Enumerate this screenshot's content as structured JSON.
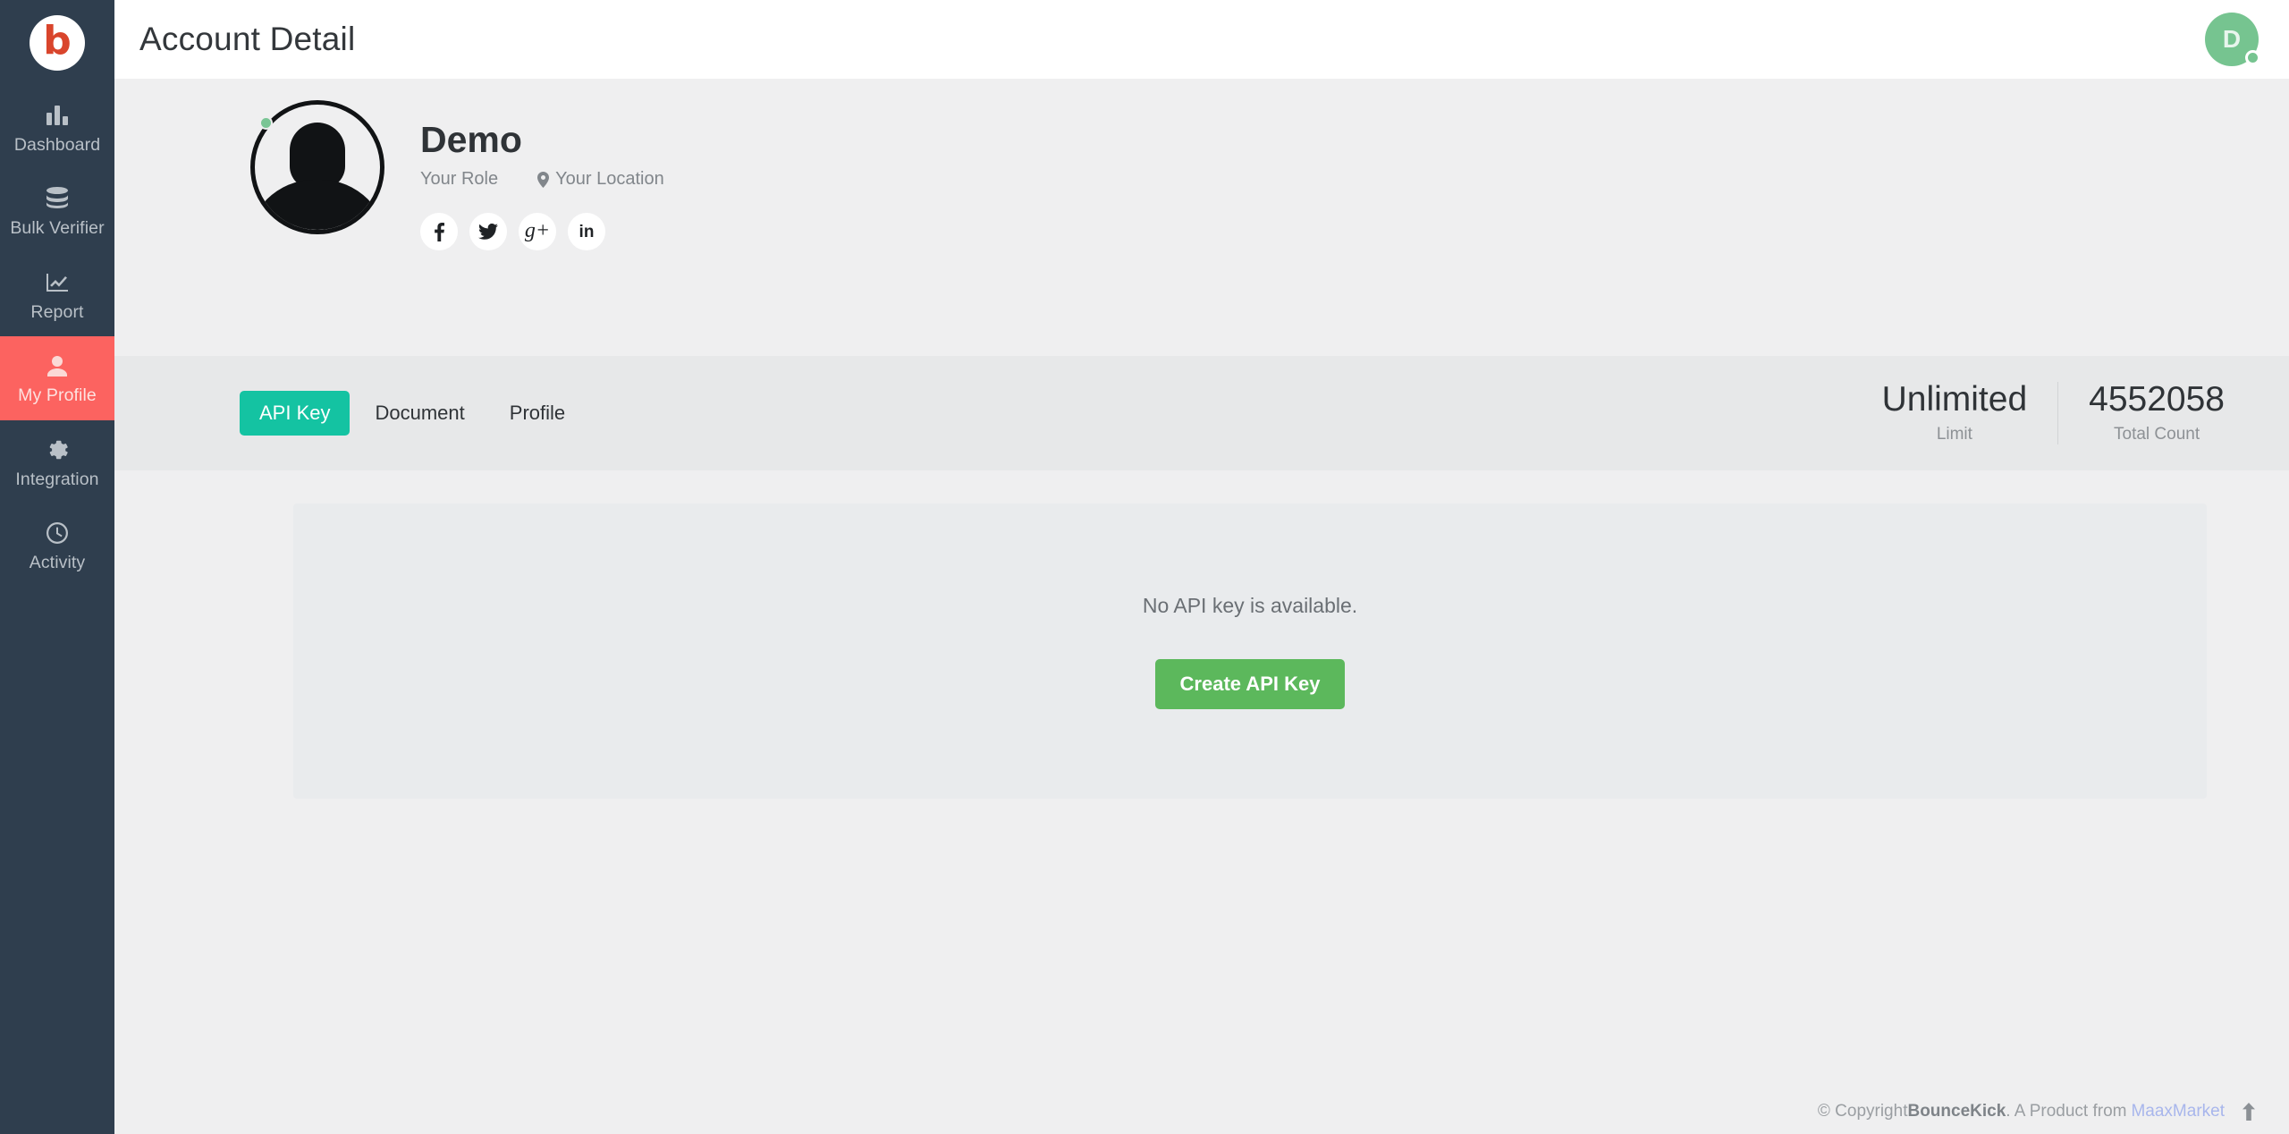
{
  "brand": {
    "logo_letter": "b",
    "logo_color": "#d9452c",
    "sidebar_bg": "#2f3e4e",
    "active_nav_bg": "#fc6360",
    "accent_teal": "#14c3a2",
    "accent_green": "#5cb85c"
  },
  "sidebar": {
    "items": [
      {
        "label": "Dashboard",
        "icon": "bar-chart-icon",
        "active": false
      },
      {
        "label": "Bulk Verifier",
        "icon": "database-icon",
        "active": false
      },
      {
        "label": "Report",
        "icon": "line-chart-icon",
        "active": false
      },
      {
        "label": "My Profile",
        "icon": "user-icon",
        "active": true
      },
      {
        "label": "Integration",
        "icon": "gear-icon",
        "active": false
      },
      {
        "label": "Activity",
        "icon": "clock-icon",
        "active": false
      }
    ]
  },
  "header": {
    "title": "Account Detail",
    "avatar_initial": "D",
    "avatar_color": "#76c490",
    "status": "online"
  },
  "profile": {
    "name": "Demo",
    "role": "Your Role",
    "location": "Your Location",
    "location_icon": "map-pin-icon",
    "online": true,
    "social": [
      {
        "name": "facebook",
        "label": "f"
      },
      {
        "name": "twitter",
        "label": ""
      },
      {
        "name": "google-plus",
        "label": "g+"
      },
      {
        "name": "linkedin",
        "label": "in"
      }
    ]
  },
  "tabs": [
    {
      "label": "API Key",
      "active": true
    },
    {
      "label": "Document",
      "active": false
    },
    {
      "label": "Profile",
      "active": false
    }
  ],
  "stats": [
    {
      "value": "Unlimited",
      "label": "Limit"
    },
    {
      "value": "4552058",
      "label": "Total Count"
    }
  ],
  "content": {
    "empty_message": "No API key is available.",
    "create_button": "Create API Key"
  },
  "footer": {
    "copyright_prefix": "© Copyright ",
    "brand": "BounceKick",
    "middle": ". A Product from",
    "product_link": "MaaxMarket",
    "to_top_icon": "arrow-up-icon"
  }
}
